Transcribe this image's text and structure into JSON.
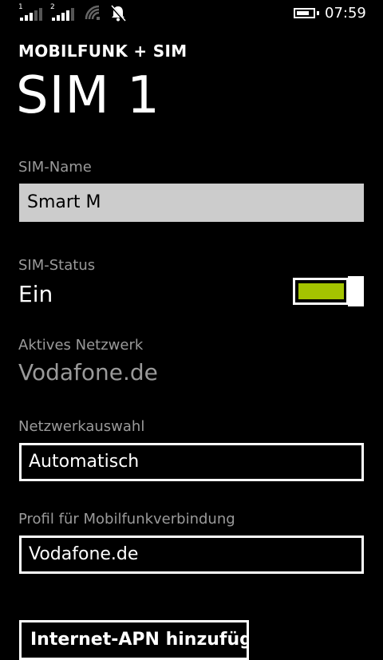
{
  "status_bar": {
    "sim1_label": "1",
    "sim2_label": "2",
    "time": "07:59",
    "battery_level": 0.8
  },
  "header": {
    "subtitle": "MOBILFUNK + SIM",
    "title": "SIM 1"
  },
  "sim_name": {
    "label": "SIM-Name",
    "value": "Smart M"
  },
  "sim_status": {
    "label": "SIM-Status",
    "value": "Ein",
    "toggle_on": true,
    "accent_color": "#a4c400"
  },
  "active_network": {
    "label": "Aktives Netzwerk",
    "value": "Vodafone.de"
  },
  "network_selection": {
    "label": "Netzwerkauswahl",
    "value": "Automatisch"
  },
  "profile": {
    "label": "Profil für Mobilfunkverbindung",
    "value": "Vodafone.de"
  },
  "apn_button": {
    "label": "Internet-APN hinzufügen"
  }
}
